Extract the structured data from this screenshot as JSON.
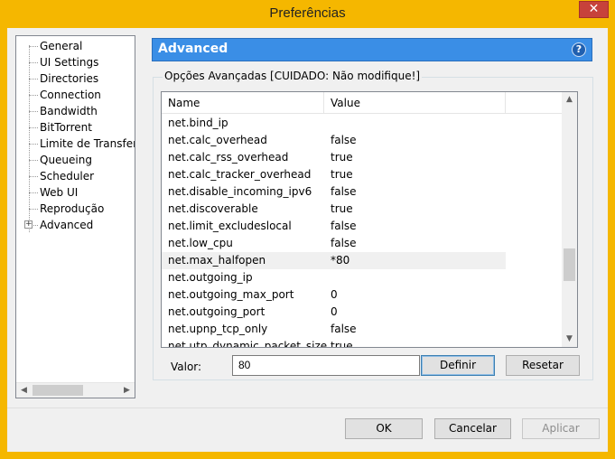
{
  "window": {
    "title": "Preferências",
    "close_glyph": "✕"
  },
  "sidebar": {
    "items": [
      {
        "label": "General"
      },
      {
        "label": "UI Settings"
      },
      {
        "label": "Directories"
      },
      {
        "label": "Connection"
      },
      {
        "label": "Bandwidth"
      },
      {
        "label": "BitTorrent"
      },
      {
        "label": "Limite de Transferência"
      },
      {
        "label": "Queueing"
      },
      {
        "label": "Scheduler"
      },
      {
        "label": "Web UI"
      },
      {
        "label": "Reprodução"
      },
      {
        "label": "Advanced",
        "expandable": true,
        "expander_glyph": "+"
      }
    ],
    "scroll_left_glyph": "◀",
    "scroll_right_glyph": "▶"
  },
  "panel": {
    "title": "Advanced",
    "help_glyph": "?",
    "group_label": "Opções Avançadas [CUIDADO: Não modifique!]"
  },
  "table": {
    "columns": [
      "Name",
      "Value"
    ],
    "rows": [
      {
        "name": "net.bind_ip",
        "value": ""
      },
      {
        "name": "net.calc_overhead",
        "value": "false"
      },
      {
        "name": "net.calc_rss_overhead",
        "value": "true"
      },
      {
        "name": "net.calc_tracker_overhead",
        "value": "true"
      },
      {
        "name": "net.disable_incoming_ipv6",
        "value": "false"
      },
      {
        "name": "net.discoverable",
        "value": "true"
      },
      {
        "name": "net.limit_excludeslocal",
        "value": "false"
      },
      {
        "name": "net.low_cpu",
        "value": "false"
      },
      {
        "name": "net.max_halfopen",
        "value": "*80",
        "selected": true
      },
      {
        "name": "net.outgoing_ip",
        "value": ""
      },
      {
        "name": "net.outgoing_max_port",
        "value": "0"
      },
      {
        "name": "net.outgoing_port",
        "value": "0"
      },
      {
        "name": "net.upnp_tcp_only",
        "value": "false"
      },
      {
        "name": "net.utp_dynamic_packet_size",
        "value": "true"
      }
    ],
    "scroll_up_glyph": "▲",
    "scroll_down_glyph": "▼"
  },
  "editor": {
    "label": "Valor:",
    "value": "80",
    "set_button": "Definir",
    "reset_button": "Resetar"
  },
  "footer": {
    "ok": "OK",
    "cancel": "Cancelar",
    "apply": "Aplicar"
  },
  "colors": {
    "window_frame": "#f5b700",
    "header_blue": "#3a8ee6",
    "close_red": "#c7423b"
  }
}
